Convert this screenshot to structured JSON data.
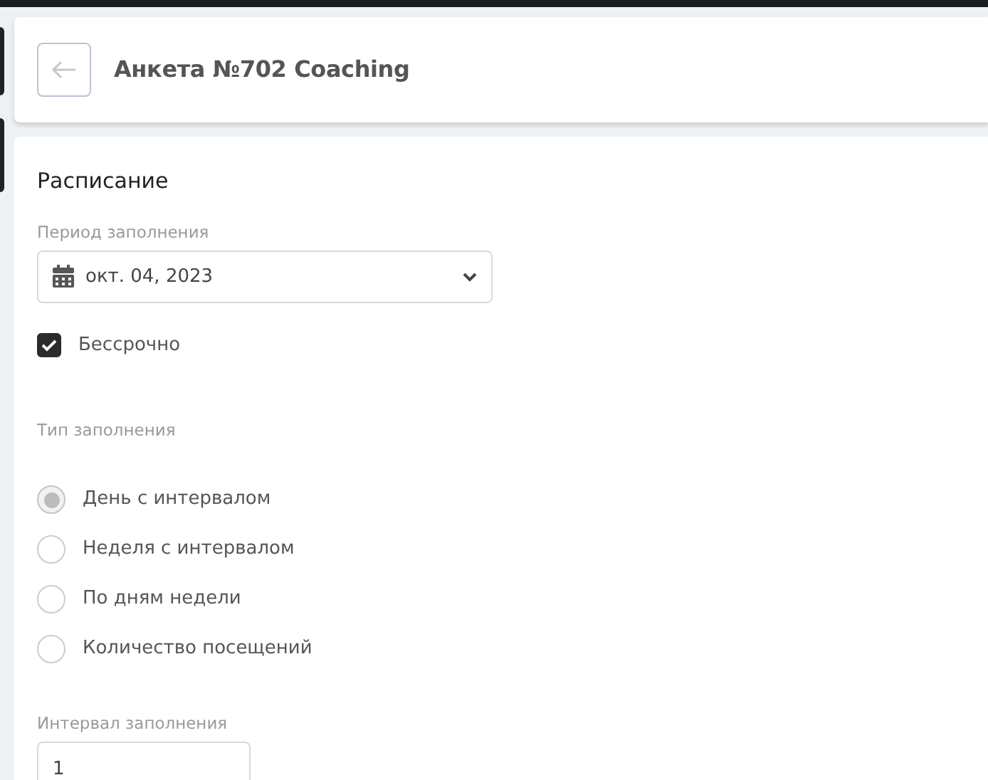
{
  "header": {
    "title": "Анкета №702 Coaching"
  },
  "schedule": {
    "title": "Расписание",
    "period": {
      "label": "Период заполнения",
      "value": "окт. 04, 2023"
    },
    "indefinite": {
      "label": "Бессрочно",
      "checked": true
    },
    "fill_type": {
      "label": "Тип заполнения",
      "options": [
        {
          "label": "День с интервалом",
          "selected": true
        },
        {
          "label": "Неделя с интервалом",
          "selected": false
        },
        {
          "label": "По дням недели",
          "selected": false
        },
        {
          "label": "Количество посещений",
          "selected": false
        }
      ]
    },
    "interval": {
      "label": "Интервал заполнения",
      "value": "1"
    }
  }
}
